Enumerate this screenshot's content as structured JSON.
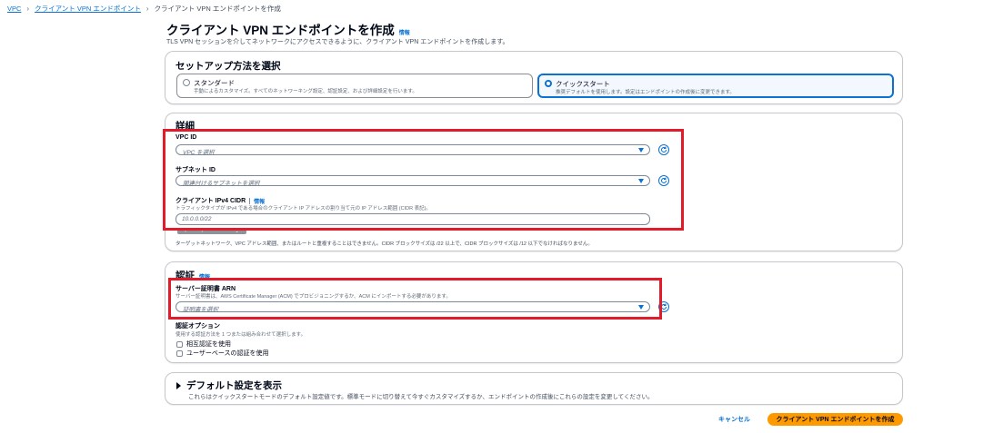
{
  "breadcrumb": {
    "items": [
      "VPC",
      "クライアント VPN エンドポイント",
      "クライアント VPN エンドポイントを作成"
    ]
  },
  "page": {
    "title": "クライアント VPN エンドポイントを作成",
    "info_link": "情報",
    "description": "TLS VPN セッションを介してネットワークにアクセスできるように、クライアント VPN エンドポイントを作成します。"
  },
  "setup": {
    "title": "セットアップ方法を選択",
    "options": [
      {
        "label": "スタンダード",
        "description": "手動によるカスタマイズ。すべてのネットワーキング設定、認証設定、および詳細設定を行います。",
        "selected": false
      },
      {
        "label": "クイックスタート",
        "description": "推奨デフォルトを使用します。設定はエンドポイントの作成後に変更できます。",
        "selected": true
      }
    ]
  },
  "details": {
    "title": "詳細",
    "vpc": {
      "label": "VPC ID",
      "placeholder": "VPC を選択"
    },
    "subnet": {
      "label": "サブネット ID",
      "placeholder": "関連付けるサブネットを選択"
    },
    "cidr": {
      "label": "クライアント IPv4 CIDR",
      "info": "情報",
      "description": "トラフィックタイプが IPv4 である場合のクライアント IP アドレスの割り当て元の IP アドレス範囲 (CIDR 表記)。",
      "placeholder": "10.0.0.0/22",
      "note": "ターゲットネットワーク、VPC アドレス範囲、またはルートと重複することはできません。CIDR ブロックサイズは /22 以上で、CIDR ブロックサイズは /12 以下でなければなりません。"
    }
  },
  "auth": {
    "title": "認証",
    "info": "情報",
    "server_cert": {
      "label": "サーバー証明書 ARN",
      "description": "サーバー証明書は、AWS Certificate Manager (ACM) でプロビジョニングするか、ACM にインポートする必要があります。",
      "placeholder": "証明書を選択"
    },
    "options": {
      "label": "認証オプション",
      "description": "使用する認証方法を 1 つまたは組み合わせて選択します。",
      "checkboxes": [
        "相互認証を使用",
        "ユーザーベースの認証を使用"
      ]
    }
  },
  "defaults": {
    "title": "デフォルト設定を表示",
    "description": "これらはクイックスタートモードのデフォルト設定値です。標準モードに切り替えて今すぐカスタマイズするか、エンドポイントの作成後にこれらの設定を変更してください。"
  },
  "footer": {
    "cancel": "キャンセル",
    "create": "クライアント VPN エンドポイントを作成"
  },
  "colors": {
    "link": "#0972d3",
    "primary_button": "#ff9900",
    "highlight": "#e21b2a"
  }
}
